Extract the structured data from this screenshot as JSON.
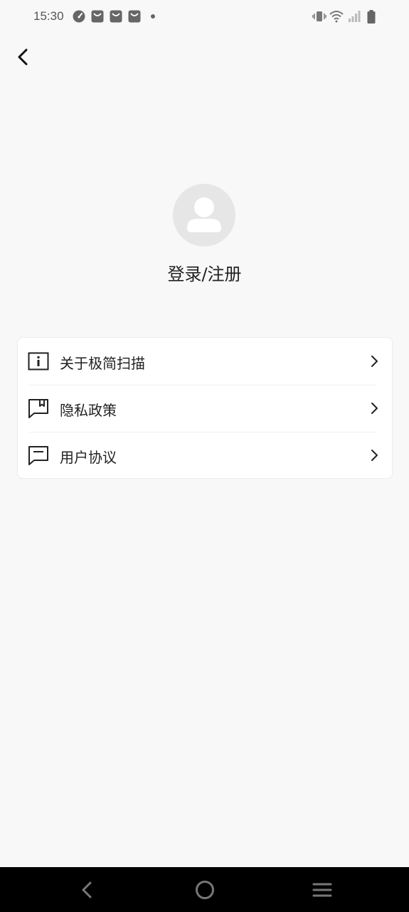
{
  "status_bar": {
    "time": "15:30",
    "notifications": [
      "speedometer-icon",
      "bag-icon",
      "bag-icon",
      "bag-icon",
      "dot-icon"
    ],
    "system": [
      "vibrate-icon",
      "wifi-icon",
      "signal-icon",
      "battery-icon"
    ]
  },
  "header": {
    "back_icon": "chevron-left-icon"
  },
  "profile": {
    "avatar_icon": "user-avatar-icon",
    "login_label": "登录/注册"
  },
  "menu": {
    "items": [
      {
        "label": "关于极简扫描",
        "icon": "info-icon"
      },
      {
        "label": "隐私政策",
        "icon": "bookmark-icon"
      },
      {
        "label": "用户协议",
        "icon": "flag-icon"
      }
    ]
  },
  "nav_bar": {
    "buttons": [
      "back-triangle-icon",
      "home-circle-icon",
      "menu-lines-icon"
    ]
  },
  "colors": {
    "background": "#f8f8f8",
    "card": "#ffffff",
    "avatar_bg": "#e6e6e6",
    "nav_bg": "#000000"
  }
}
